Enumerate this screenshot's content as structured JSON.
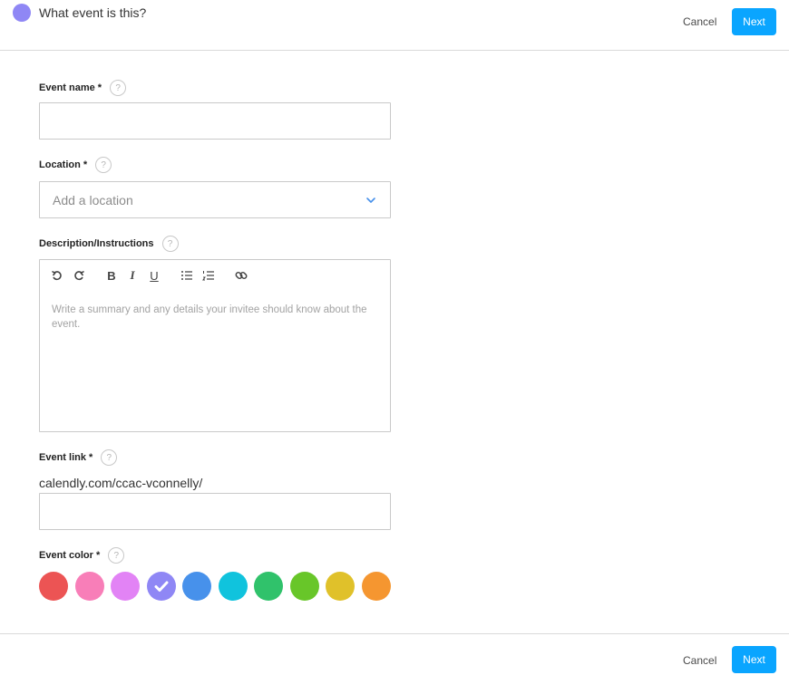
{
  "header": {
    "title": "What event is this?",
    "dot_color": "#8f87f5",
    "cancel_label": "Cancel",
    "next_label": "Next"
  },
  "form": {
    "event_name": {
      "label": "Event name *",
      "value": "",
      "help": "?"
    },
    "location": {
      "label": "Location *",
      "placeholder": "Add a location",
      "help": "?",
      "icon": "chevron-down-icon"
    },
    "description": {
      "label": "Description/Instructions",
      "help": "?",
      "placeholder": "Write a summary and any details your invitee should know about the event.",
      "toolbar": [
        {
          "name": "undo-icon"
        },
        {
          "name": "redo-icon"
        },
        {
          "name": "bold-icon",
          "glyph": "B"
        },
        {
          "name": "italic-icon",
          "glyph": "I"
        },
        {
          "name": "underline-icon",
          "glyph": "U"
        },
        {
          "name": "bullet-list-icon"
        },
        {
          "name": "numbered-list-icon"
        },
        {
          "name": "link-icon"
        }
      ]
    },
    "event_link": {
      "label": "Event link *",
      "help": "?",
      "prefix": "calendly.com/ccac-vconnelly/",
      "value": ""
    },
    "event_color": {
      "label": "Event color *",
      "help": "?",
      "selected_index": 3,
      "colors": [
        "#ec5454",
        "#f87eb8",
        "#e283f5",
        "#8f87f5",
        "#4791eb",
        "#10c3dd",
        "#30c26b",
        "#68c629",
        "#e0c12a",
        "#f59630"
      ]
    }
  },
  "footer": {
    "cancel_label": "Cancel",
    "next_label": "Next"
  },
  "theme": {
    "accent": "#0aa5ff"
  }
}
